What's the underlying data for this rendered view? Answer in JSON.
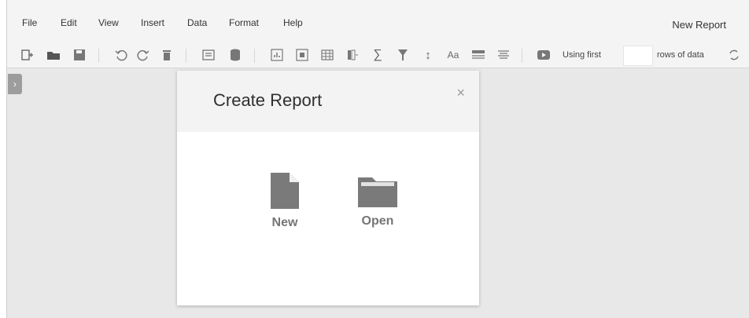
{
  "menu": {
    "items": [
      "File",
      "Edit",
      "View",
      "Insert",
      "Data",
      "Format",
      "Help"
    ],
    "title": "New Report"
  },
  "toolbar": {
    "using_first_label": "Using first",
    "rows_input_value": "",
    "rows_of_data_label": "rows of data",
    "icons": [
      "new-report-icon",
      "open-folder-icon",
      "save-icon",
      "undo-icon",
      "redo-icon",
      "delete-icon",
      "table-layout-icon",
      "database-icon",
      "chart-icon",
      "frame-icon",
      "grid-icon",
      "column-add-icon",
      "sum-icon",
      "filter-icon",
      "sort-icon",
      "font-icon",
      "style-icon",
      "align-icon",
      "play-icon",
      "refresh-icon"
    ]
  },
  "dialog": {
    "title": "Create Report",
    "close": "×",
    "options": [
      {
        "label": "New",
        "icon": "file-icon"
      },
      {
        "label": "Open",
        "icon": "folder-icon"
      }
    ]
  },
  "sidebar": {
    "toggle": "›"
  }
}
